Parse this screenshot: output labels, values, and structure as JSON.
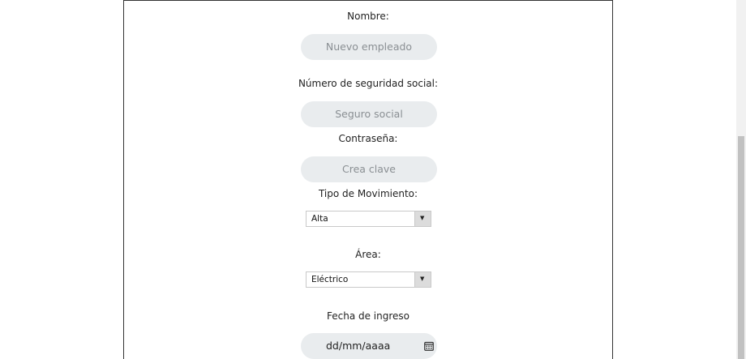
{
  "form": {
    "nombre": {
      "label": "Nombre:",
      "placeholder": "Nuevo empleado"
    },
    "seguro": {
      "label": "Número de seguridad social:",
      "placeholder": "Seguro social"
    },
    "password": {
      "label": "Contraseña:",
      "placeholder": "Crea clave"
    },
    "movimiento": {
      "label": "Tipo de Movimiento:",
      "selected": "Alta"
    },
    "area": {
      "label": "Área:",
      "selected": "Eléctrico"
    },
    "fecha": {
      "label": "Fecha de ingreso",
      "value": "dd/mm/aaaa"
    }
  },
  "icons": {
    "dropdown": "chevron-down-icon",
    "calendar": "calendar-icon"
  }
}
